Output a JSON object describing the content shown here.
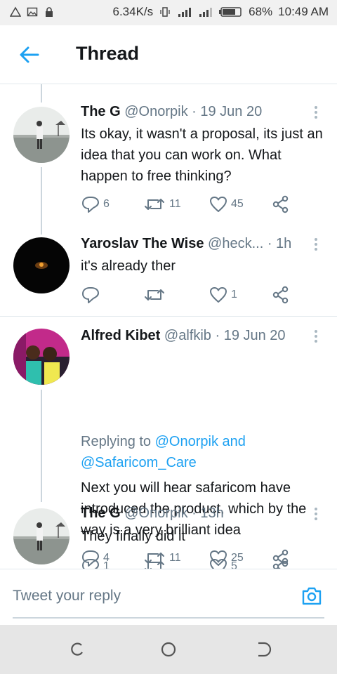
{
  "status_bar": {
    "speed": "6.34K/s",
    "battery": "68%",
    "time": "10:49 AM"
  },
  "header": {
    "title": "Thread"
  },
  "tweets": [
    {
      "name": "The G",
      "handle": "@Onorpik",
      "time": "19 Jun 20",
      "text": "Its okay, it wasn't a proposal, its just an idea that you can work on. What happen to free thinking?",
      "replies": "6",
      "retweets": "11",
      "likes": "45"
    },
    {
      "name": "Yaroslav The Wise",
      "handle": "@heck...",
      "time": "1h",
      "text": "it's already ther",
      "replies": "",
      "retweets": "",
      "likes": "1"
    },
    {
      "name": "Alfred Kibet",
      "handle": "@alfkib",
      "time": "19 Jun 20",
      "replying_prefix": "Replying to ",
      "replying_to": "@Onorpik and @Safaricom_Care",
      "text": "Next you will hear safaricom have introduced the product, which by the way is a very brilliant idea",
      "replies": "4",
      "retweets": "11",
      "likes": "25"
    },
    {
      "name": "The G",
      "handle": "@Onorpik",
      "time": "13h",
      "text": "They finally did it",
      "replies": "1",
      "retweets": "",
      "likes": "5"
    }
  ],
  "reply_bar": {
    "placeholder": "Tweet your reply"
  },
  "colors": {
    "accent": "#1da1f2",
    "text": "#14171a",
    "muted": "#657786"
  }
}
